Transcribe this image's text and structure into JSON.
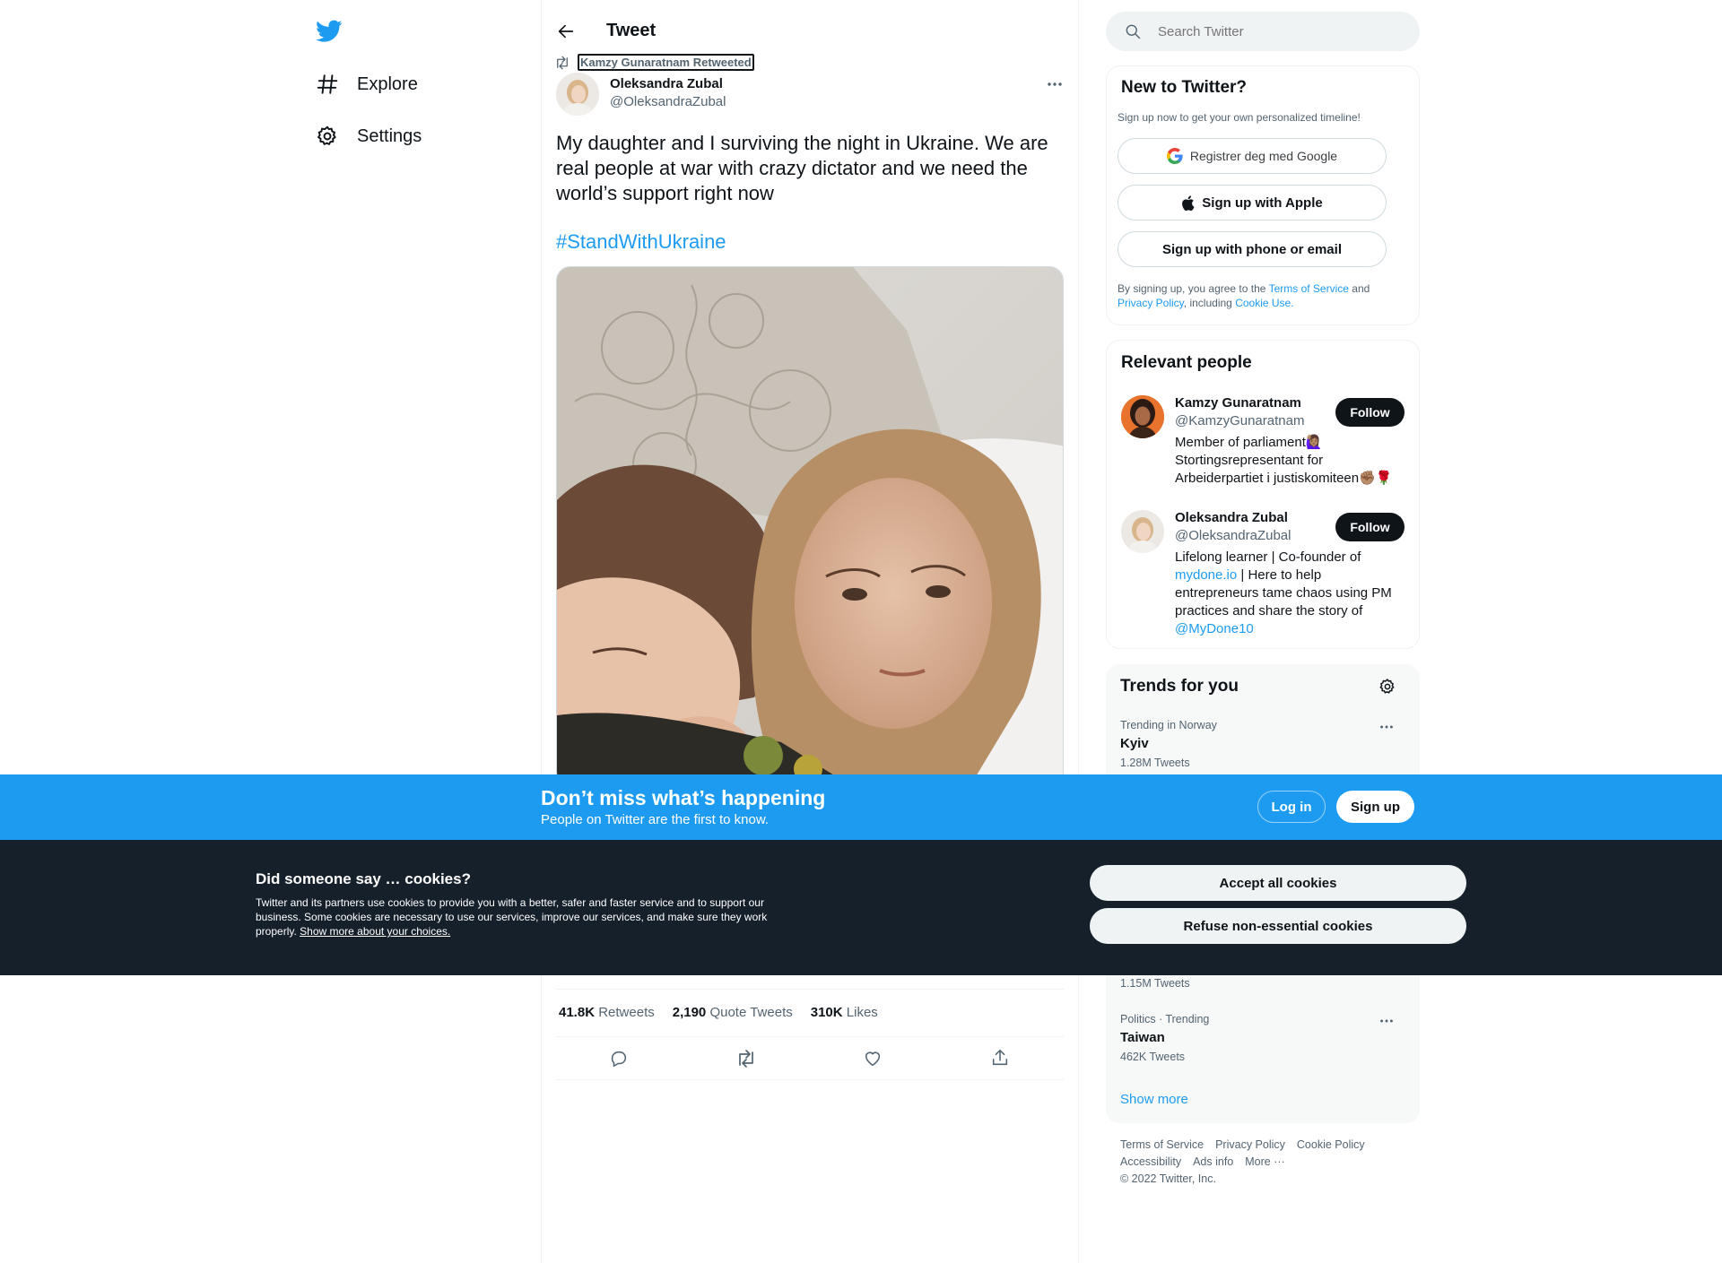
{
  "nav": {
    "logo": "twitter-bird-icon",
    "items": [
      {
        "label": "Explore",
        "icon": "hashtag-icon"
      },
      {
        "label": "Settings",
        "icon": "gear-icon"
      }
    ]
  },
  "header": {
    "title": "Tweet",
    "back_icon": "back-arrow-icon"
  },
  "tweet": {
    "retweeted_by": "Kamzy Gunaratnam Retweeted",
    "author_name": "Oleksandra Zubal",
    "author_handle": "@OleksandraZubal",
    "text": "My daughter and I surviving the night in Ukraine. We are real people at war with crazy dictator and we need the world’s support right now",
    "hashtag": "#StandWithUkraine",
    "stats": [
      {
        "num": "41.8K",
        "label": "Retweets"
      },
      {
        "num": "2,190",
        "label": "Quote Tweets"
      },
      {
        "num": "310K",
        "label": "Likes"
      }
    ],
    "actions": [
      "reply-icon",
      "retweet-icon",
      "like-icon",
      "share-icon"
    ]
  },
  "search": {
    "placeholder": "Search Twitter"
  },
  "signup": {
    "title": "New to Twitter?",
    "subtitle": "Sign up now to get your own personalized timeline!",
    "google": "Registrer deg med Google",
    "apple": "Sign up with Apple",
    "phone": "Sign up with phone or email",
    "legal_1": "By signing up, you agree to the",
    "terms": "Terms of Service",
    "and": "and",
    "privacy": "Privacy Policy",
    "including": ", including",
    "cookie_use": "Cookie Use."
  },
  "relevant": {
    "title": "Relevant people",
    "people": [
      {
        "name": "Kamzy Gunaratnam",
        "handle": "@KamzyGunaratnam",
        "follow": "Follow",
        "bio_1": "Member of parliament🙋🏽‍♀️",
        "bio_2": "Stortingsrepresentant for",
        "bio_3": "Arbeiderpartiet i justiskomiteen✊🏽🌹"
      },
      {
        "name": "Oleksandra Zubal",
        "handle": "@OleksandraZubal",
        "follow": "Follow",
        "bio_1": "Lifelong learner | Co-founder of",
        "bio_link": "mydone.io",
        "bio_2": " | Here to help",
        "bio_3": "entrepreneurs tame chaos using PM",
        "bio_4": "practices and share the story of",
        "bio_mention": "@MyDone10"
      }
    ]
  },
  "trends": {
    "title": "Trends for you",
    "items": [
      {
        "context": "Trending in Norway",
        "name": "Kyiv",
        "count": "1.28M Tweets"
      },
      {
        "context": "",
        "name": "",
        "count": "1.15M Tweets"
      },
      {
        "context": "Politics · Trending",
        "name": "Taiwan",
        "count": "462K Tweets"
      }
    ],
    "show_more": "Show more"
  },
  "footer": {
    "links_row1": [
      "Terms of Service",
      "Privacy Policy",
      "Cookie Policy"
    ],
    "links_row2": [
      "Accessibility",
      "Ads info",
      "More ···"
    ],
    "copyright": "© 2022 Twitter, Inc."
  },
  "banner": {
    "title": "Don’t miss what’s happening",
    "subtitle": "People on Twitter are the first to know.",
    "login": "Log in",
    "signup": "Sign up"
  },
  "cookies": {
    "title": "Did someone say … cookies?",
    "body_1": "Twitter and its partners use cookies to provide you with a better, safer and faster service and to support our",
    "body_2": "business. Some cookies are necessary to use our services, improve our services, and make sure they work",
    "body_3": "properly.",
    "link": "Show more about your choices.",
    "accept": "Accept all cookies",
    "refuse": "Refuse non-essential cookies"
  },
  "colors": {
    "brand": "#1d9bf0",
    "dark": "#0f1419",
    "cookie_bg": "#15202b"
  }
}
